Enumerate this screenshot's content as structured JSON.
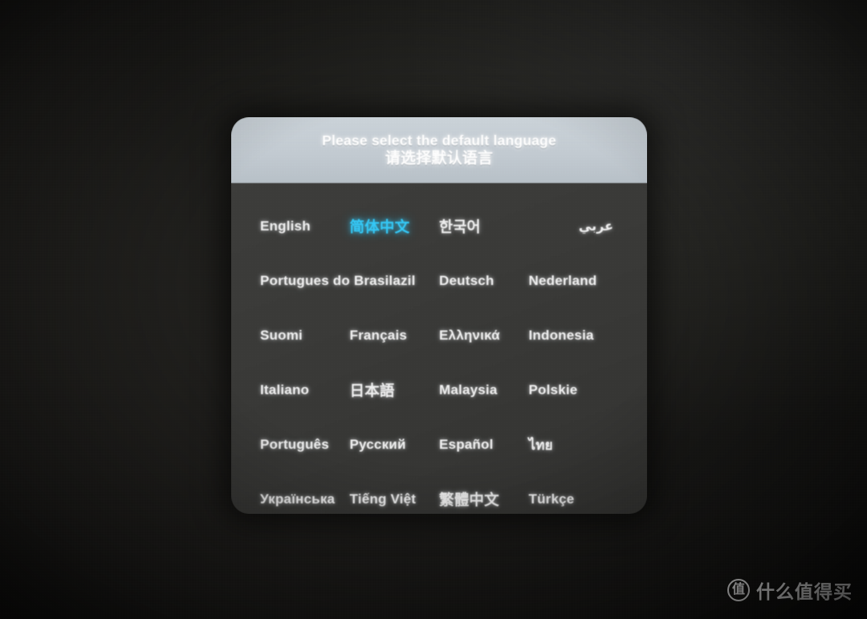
{
  "screen": {
    "background_color": "#1d1c1a",
    "panel_body_color": "#3a3a38",
    "panel_header_color": "#c4ccd3",
    "text_color": "#f0f0f0",
    "selected_color": "#34c9f7"
  },
  "dialog": {
    "title_en": "Please select the default language",
    "title_zh": "请选择默认语言"
  },
  "languages": {
    "rows": [
      [
        {
          "label": "English",
          "selected": false,
          "span": 1,
          "script": "latin"
        },
        {
          "label": "简体中文",
          "selected": true,
          "span": 1,
          "script": "cjk"
        },
        {
          "label": "한국어",
          "selected": false,
          "span": 1,
          "script": "cjk"
        },
        {
          "label": "عربي",
          "selected": false,
          "span": 1,
          "script": "rtl"
        }
      ],
      [
        {
          "label": "Portugues do Brasilazil",
          "selected": false,
          "span": 2,
          "script": "latin"
        },
        {
          "label": "Deutsch",
          "selected": false,
          "span": 1,
          "script": "latin"
        },
        {
          "label": "Nederland",
          "selected": false,
          "span": 1,
          "script": "latin"
        }
      ],
      [
        {
          "label": "Suomi",
          "selected": false,
          "span": 1,
          "script": "latin"
        },
        {
          "label": "Français",
          "selected": false,
          "span": 1,
          "script": "latin"
        },
        {
          "label": "Ελληνικά",
          "selected": false,
          "span": 1,
          "script": "greek"
        },
        {
          "label": "Indonesia",
          "selected": false,
          "span": 1,
          "script": "latin"
        }
      ],
      [
        {
          "label": "Italiano",
          "selected": false,
          "span": 1,
          "script": "latin"
        },
        {
          "label": "日本語",
          "selected": false,
          "span": 1,
          "script": "cjk"
        },
        {
          "label": "Malaysia",
          "selected": false,
          "span": 1,
          "script": "latin"
        },
        {
          "label": "Polskie",
          "selected": false,
          "span": 1,
          "script": "latin"
        }
      ],
      [
        {
          "label": "Português",
          "selected": false,
          "span": 1,
          "script": "latin"
        },
        {
          "label": "Русский",
          "selected": false,
          "span": 1,
          "script": "cyrillic"
        },
        {
          "label": "Español",
          "selected": false,
          "span": 1,
          "script": "latin"
        },
        {
          "label": "ไทย",
          "selected": false,
          "span": 1,
          "script": "thai"
        }
      ],
      [
        {
          "label": "Українська",
          "selected": false,
          "span": 1,
          "script": "cyrillic"
        },
        {
          "label": "Tiếng Việt",
          "selected": false,
          "span": 1,
          "script": "latin"
        },
        {
          "label": "繁體中文",
          "selected": false,
          "span": 1,
          "script": "cjk"
        },
        {
          "label": "Türkçe",
          "selected": false,
          "span": 1,
          "script": "latin"
        }
      ]
    ]
  },
  "watermark": {
    "badge_glyph": "值",
    "text": "什么值得买"
  }
}
